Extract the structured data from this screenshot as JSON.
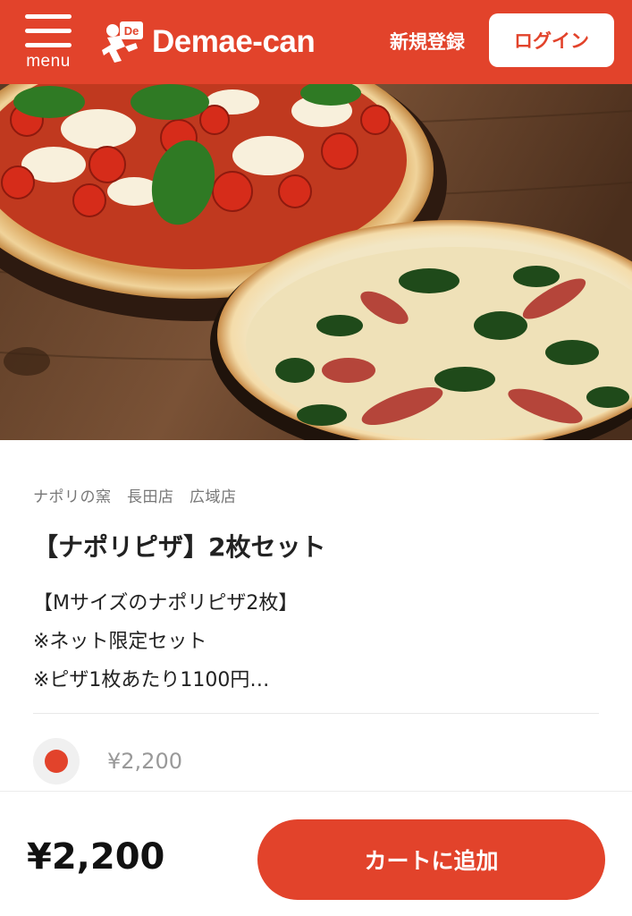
{
  "header": {
    "menu_label": "menu",
    "logo_text": "Demae-can",
    "logo_mark_text": "De",
    "signup_label": "新規登録",
    "login_label": "ログイン",
    "brand_color": "#e2432b"
  },
  "hero": {
    "image_subject": "pizza-photo"
  },
  "item": {
    "shop_name": "ナポリの窯　長田店　広域店",
    "title": "【ナポリピザ】2枚セット",
    "description_lines": [
      "【Mサイズのナポリピザ2枚】",
      "※ネット限定セット",
      "※ピザ1枚あたり1100円…"
    ]
  },
  "option": {
    "price": "¥2,200",
    "selected": true
  },
  "footer": {
    "total_price": "¥2,200",
    "add_to_cart_label": "カートに追加"
  }
}
